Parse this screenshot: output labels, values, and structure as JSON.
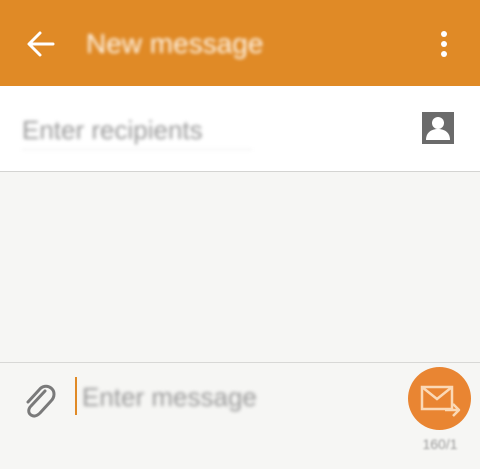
{
  "header": {
    "title": "New message",
    "back_icon": "back-arrow-icon",
    "menu_icon": "more-vertical-icon"
  },
  "recipients": {
    "placeholder": "Enter recipients",
    "contact_icon": "contact-icon"
  },
  "compose": {
    "placeholder": "Enter message",
    "attach_icon": "paperclip-icon",
    "send_icon": "send-message-icon",
    "counter": "160/1"
  },
  "colors": {
    "accent": "#e08a26",
    "send_button": "#e98532",
    "background": "#f6f6f4"
  }
}
